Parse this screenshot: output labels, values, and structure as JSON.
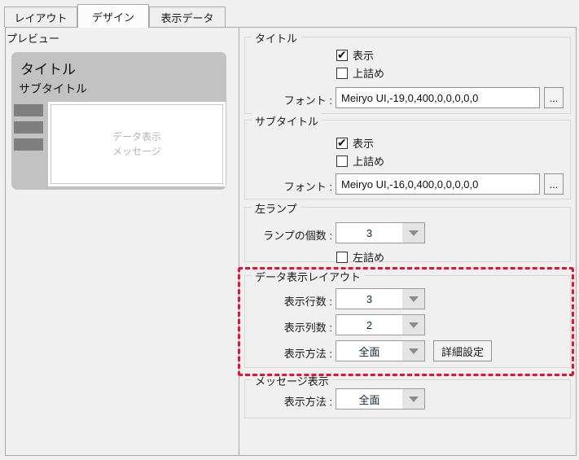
{
  "tabs": [
    {
      "label": "レイアウト",
      "active": false
    },
    {
      "label": "デザイン",
      "active": true
    },
    {
      "label": "表示データ",
      "active": false
    }
  ],
  "preview": {
    "caption": "プレビュー",
    "title": "タイトル",
    "subtitle": "サブタイトル",
    "message_line1": "データ表示",
    "message_line2": "メッセージ",
    "lamp_count": 3
  },
  "groups": {
    "title": {
      "legend": "タイトル",
      "show_label": "表示",
      "show_checked": true,
      "top_align_label": "上詰め",
      "top_align_checked": false,
      "font_label": "フォント :",
      "font_value": "Meiryo UI,-19,0,400,0,0,0,0,0",
      "more_label": "..."
    },
    "subtitle": {
      "legend": "サブタイトル",
      "show_label": "表示",
      "show_checked": true,
      "top_align_label": "上詰め",
      "top_align_checked": false,
      "font_label": "フォント :",
      "font_value": "Meiryo UI,-16,0,400,0,0,0,0,0",
      "more_label": "..."
    },
    "left_lamp": {
      "legend": "左ランプ",
      "count_label": "ランプの個数 :",
      "count_value": "3",
      "left_align_label": "左詰め",
      "left_align_checked": false
    },
    "data_layout": {
      "legend": "データ表示レイアウト",
      "rows_label": "表示行数 :",
      "rows_value": "3",
      "cols_label": "表示列数 :",
      "cols_value": "2",
      "method_label": "表示方法 :",
      "method_value": "全面",
      "detail_button": "詳細設定"
    },
    "message": {
      "legend": "メッセージ表示",
      "method_label": "表示方法 :",
      "method_value": "全面"
    }
  },
  "colors": {
    "highlight_red": "#e8112d",
    "preview_panel_gray": "#c2c2c2",
    "lamp_gray": "#7f7f7f",
    "background": "#f0f0f0"
  }
}
